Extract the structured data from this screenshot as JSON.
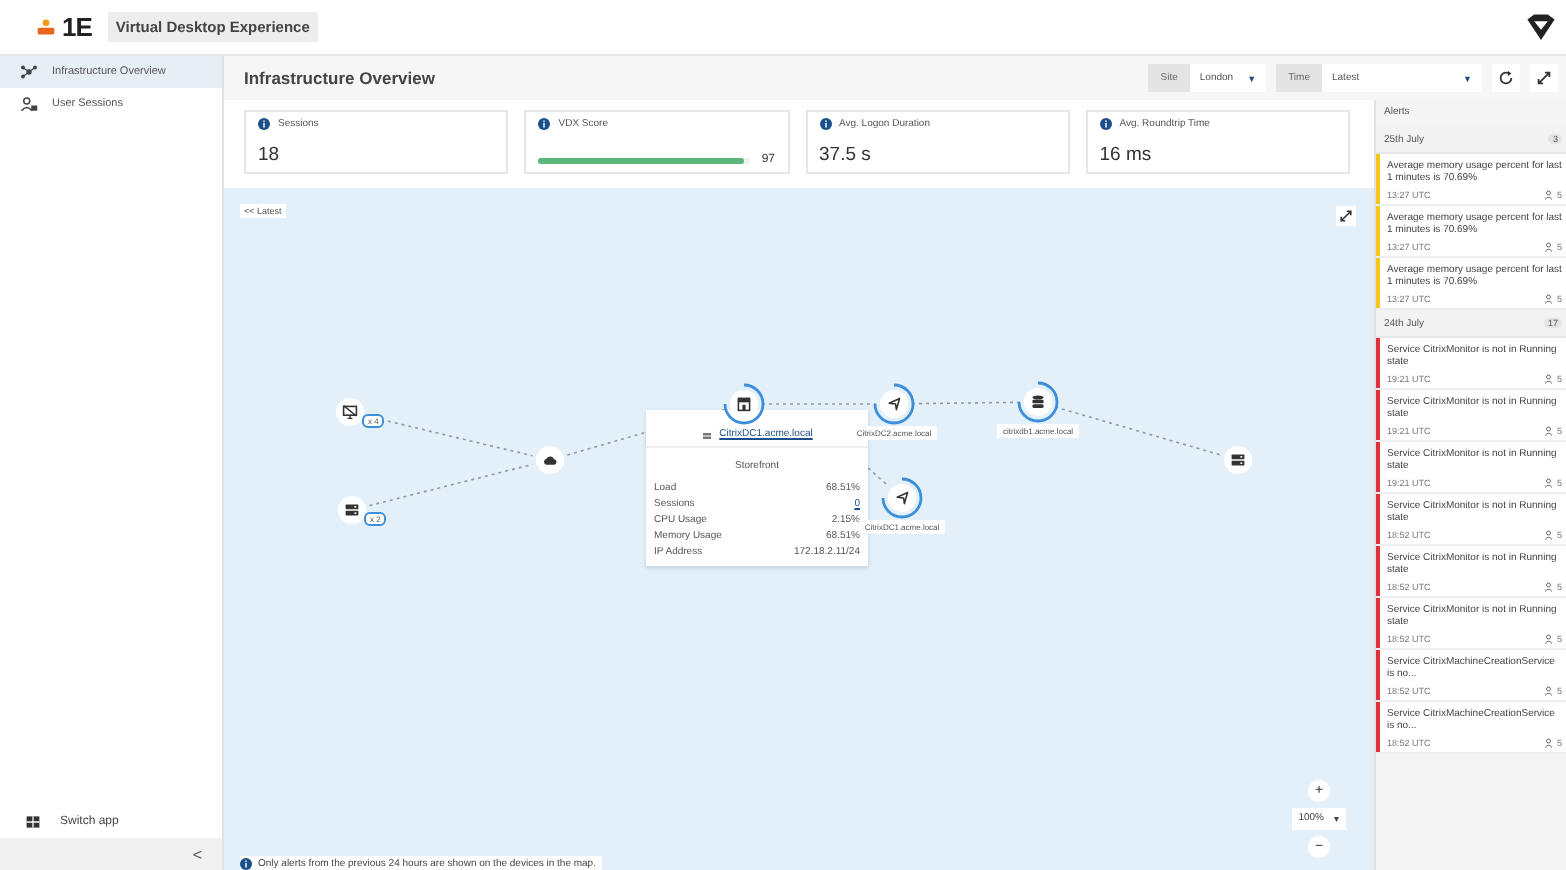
{
  "header": {
    "logo": "1E",
    "app_title": "Virtual Desktop Experience"
  },
  "sidebar": {
    "items": [
      {
        "label": "Infrastructure Overview",
        "selected": true
      },
      {
        "label": "User Sessions",
        "selected": false
      }
    ],
    "switch_app": "Switch app",
    "collapse": "<"
  },
  "page": {
    "title": "Infrastructure Overview",
    "filters": [
      {
        "label": "Site",
        "value": "London",
        "dropdown": "▼"
      },
      {
        "label": "Time",
        "value": "Latest",
        "dropdown": "▼"
      }
    ]
  },
  "kpis": [
    {
      "label": "Sessions",
      "value": "18"
    },
    {
      "label": "VDX Score",
      "value": "97",
      "level": 0.97
    },
    {
      "label": "Avg. Logon Duration",
      "value": "37.5 s"
    },
    {
      "label": "Avg. Roundtrip Time",
      "value": "16 ms"
    }
  ],
  "map": {
    "latest_badge": "<< Latest",
    "nodes": [
      {
        "kind": "monitor",
        "badge": "x 4"
      },
      {
        "kind": "server",
        "badge": "x 2"
      },
      {
        "kind": "cloud"
      },
      {
        "kind": "storefront",
        "ring": true
      },
      {
        "kind": "controller",
        "label": "CitrixDC2.acme.local",
        "ring": true
      },
      {
        "kind": "database",
        "label": "citrixdb1.acme.local",
        "ring": true
      },
      {
        "kind": "controller",
        "label": "CitrixDC1.acme.local",
        "ring": true
      },
      {
        "kind": "server"
      }
    ],
    "tooltip": {
      "host": "CitrixDC1.acme.local",
      "role": "Storefront",
      "rows": [
        {
          "label": "Load",
          "value": "68.51%",
          "link": false
        },
        {
          "label": "Sessions",
          "value": "0",
          "link": true
        },
        {
          "label": "CPU Usage",
          "value": "2.15%",
          "link": false
        },
        {
          "label": "Memory Usage",
          "value": "68.51%",
          "link": false
        },
        {
          "label": "IP Address",
          "value": "172.18.2.11/24",
          "link": false
        }
      ]
    },
    "zoom": {
      "plus": "+",
      "level": "100%",
      "dropdown": "▾",
      "minus": "−"
    },
    "note": "Only alerts from the previous 24 hours are shown on the devices in the map."
  },
  "alerts": {
    "title": "Alerts",
    "groups": [
      {
        "date": "25th July",
        "count": "3",
        "items": [
          {
            "text": "Average memory usage percent for last 1 minutes is 70.69%",
            "time": "13:27 UTC",
            "users": "5",
            "color": "#f5c518"
          },
          {
            "text": "Average memory usage percent for last 1 minutes is 70.69%",
            "time": "13:27 UTC",
            "users": "5",
            "color": "#f5c518"
          },
          {
            "text": "Average memory usage percent for last 1 minutes is 70.69%",
            "time": "13:27 UTC",
            "users": "5",
            "color": "#f5c518"
          }
        ]
      },
      {
        "date": "24th July",
        "count": "17",
        "items": [
          {
            "text": "Service CitrixMonitor is not in Running state",
            "time": "19:21 UTC",
            "users": "5",
            "color": "#e0303a"
          },
          {
            "text": "Service CitrixMonitor is not in Running state",
            "time": "19:21 UTC",
            "users": "5",
            "color": "#e0303a"
          },
          {
            "text": "Service CitrixMonitor is not in Running state",
            "time": "19:21 UTC",
            "users": "5",
            "color": "#e0303a"
          },
          {
            "text": "Service CitrixMonitor is not in Running state",
            "time": "18:52 UTC",
            "users": "5",
            "color": "#e0303a"
          },
          {
            "text": "Service CitrixMonitor is not in Running state",
            "time": "18:52 UTC",
            "users": "5",
            "color": "#e0303a"
          },
          {
            "text": "Service CitrixMonitor is not in Running state",
            "time": "18:52 UTC",
            "users": "5",
            "color": "#e0303a"
          },
          {
            "text": "Service CitrixMachineCreationService is no...",
            "time": "18:52 UTC",
            "users": "5",
            "color": "#e0303a"
          },
          {
            "text": "Service CitrixMachineCreationService is no...",
            "time": "18:52 UTC",
            "users": "5",
            "color": "#e0303a"
          }
        ]
      }
    ]
  }
}
